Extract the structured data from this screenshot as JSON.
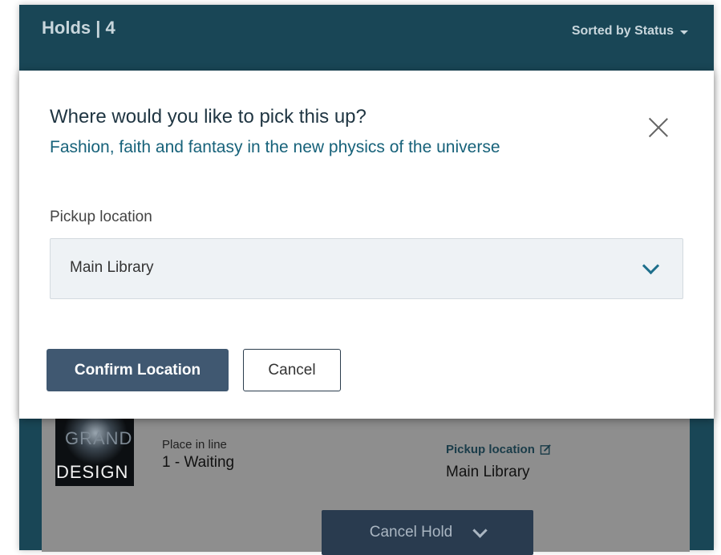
{
  "holds_header": {
    "title": "Holds | 4",
    "sort_label": "Sorted by Status"
  },
  "hold_item": {
    "cover_words": [
      "GRAND",
      "DESIGN"
    ],
    "place_in_line_label": "Place in line",
    "place_in_line_value": "1 - Waiting",
    "pickup_location_label": "Pickup location",
    "pickup_location_value": "Main Library",
    "cancel_hold_label": "Cancel Hold"
  },
  "modal": {
    "title": "Where would you like to pick this up?",
    "subtitle": "Fashion, faith and fantasy in the new physics of the universe",
    "field_label": "Pickup location",
    "selected_location": "Main Library",
    "confirm_label": "Confirm Location",
    "cancel_label": "Cancel"
  },
  "colors": {
    "header_bg": "#194656",
    "primary_button": "#405871",
    "accent_text": "#17627a"
  }
}
